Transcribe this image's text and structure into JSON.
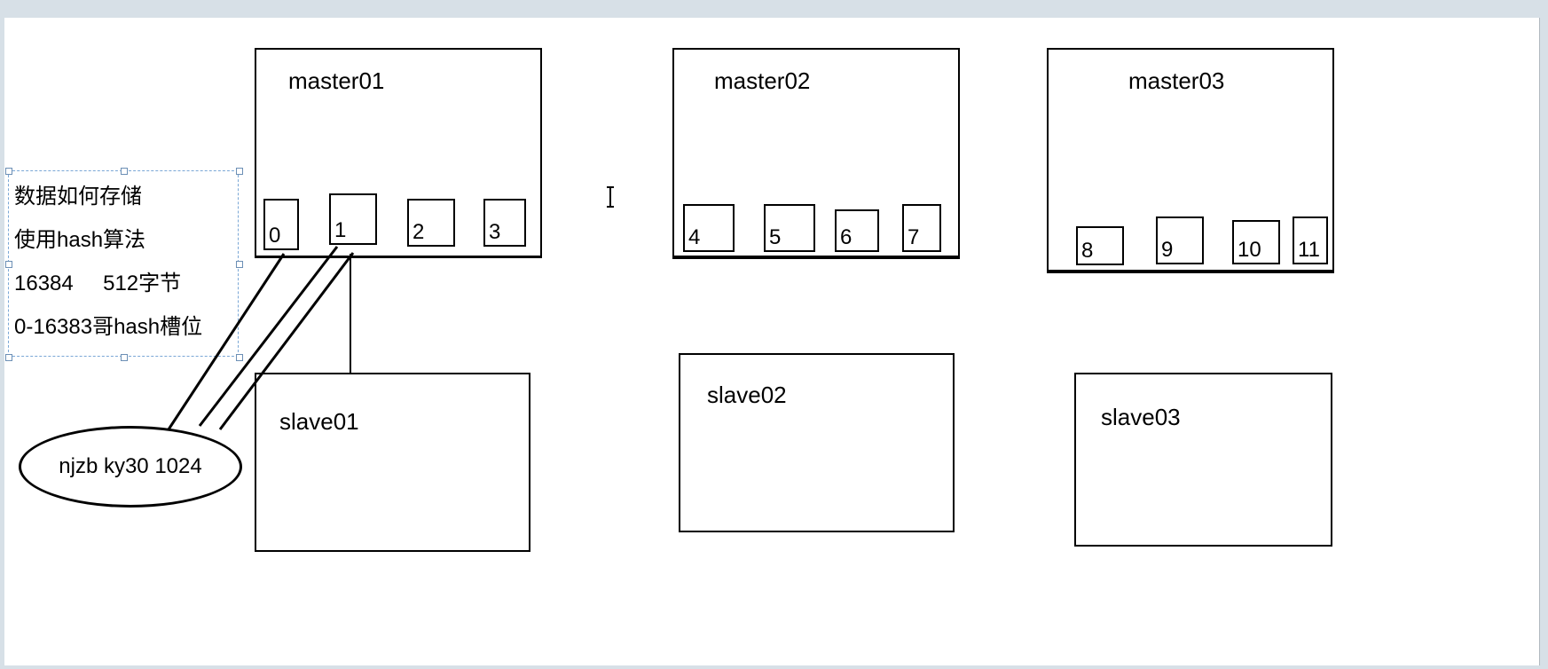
{
  "masters": [
    {
      "label": "master01",
      "slots": [
        "0",
        "1",
        "2",
        "3"
      ]
    },
    {
      "label": "master02",
      "slots": [
        "4",
        "5",
        "6",
        "7"
      ]
    },
    {
      "label": "master03",
      "slots": [
        "8",
        "9",
        "10",
        "11"
      ]
    }
  ],
  "slaves": [
    {
      "label": "slave01"
    },
    {
      "label": "slave02"
    },
    {
      "label": "slave03"
    }
  ],
  "notes": {
    "line1": "数据如何存储",
    "line2": "使用hash算法",
    "line3a": "16384",
    "line3b": "512字节",
    "line4": "0-16383哥hash槽位"
  },
  "ellipse_label": "njzb ky30 1024"
}
